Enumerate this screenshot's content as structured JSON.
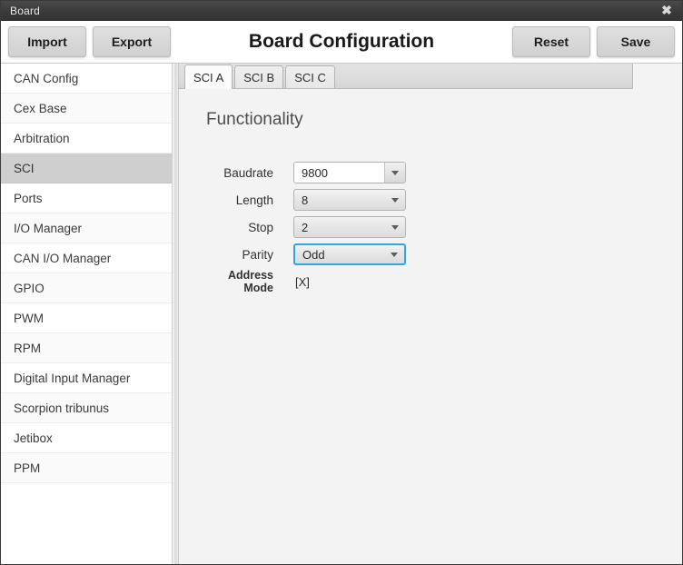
{
  "window": {
    "title": "Board",
    "close_label": "✖"
  },
  "toolbar": {
    "import_label": "Import",
    "export_label": "Export",
    "reset_label": "Reset",
    "save_label": "Save",
    "page_title": "Board Configuration"
  },
  "sidebar": {
    "items": [
      {
        "label": "CAN Config",
        "active": false
      },
      {
        "label": "Cex Base",
        "active": false
      },
      {
        "label": "Arbitration",
        "active": false
      },
      {
        "label": "SCI",
        "active": true
      },
      {
        "label": "Ports",
        "active": false
      },
      {
        "label": "I/O Manager",
        "active": false
      },
      {
        "label": "CAN I/O Manager",
        "active": false
      },
      {
        "label": "GPIO",
        "active": false
      },
      {
        "label": "PWM",
        "active": false
      },
      {
        "label": "RPM",
        "active": false
      },
      {
        "label": "Digital Input Manager",
        "active": false
      },
      {
        "label": "Scorpion tribunus",
        "active": false
      },
      {
        "label": "Jetibox",
        "active": false
      },
      {
        "label": "PPM",
        "active": false
      }
    ]
  },
  "content": {
    "tabs": [
      {
        "label": "SCI A",
        "active": true
      },
      {
        "label": "SCI B",
        "active": false
      },
      {
        "label": "SCI C",
        "active": false
      }
    ],
    "section_heading": "Functionality",
    "fields": {
      "baudrate": {
        "label": "Baudrate",
        "value": "9800"
      },
      "length": {
        "label": "Length",
        "value": "8"
      },
      "stop": {
        "label": "Stop",
        "value": "2"
      },
      "parity": {
        "label": "Parity",
        "value": "Odd"
      },
      "address_mode": {
        "label": "Address Mode",
        "value": "[X]"
      }
    }
  },
  "colors": {
    "focus_accent": "#2ba8e0",
    "titlebar": "#3c3c3c",
    "sidebar_active": "#cfcfcf",
    "panel_bg": "#f3f3f3"
  }
}
